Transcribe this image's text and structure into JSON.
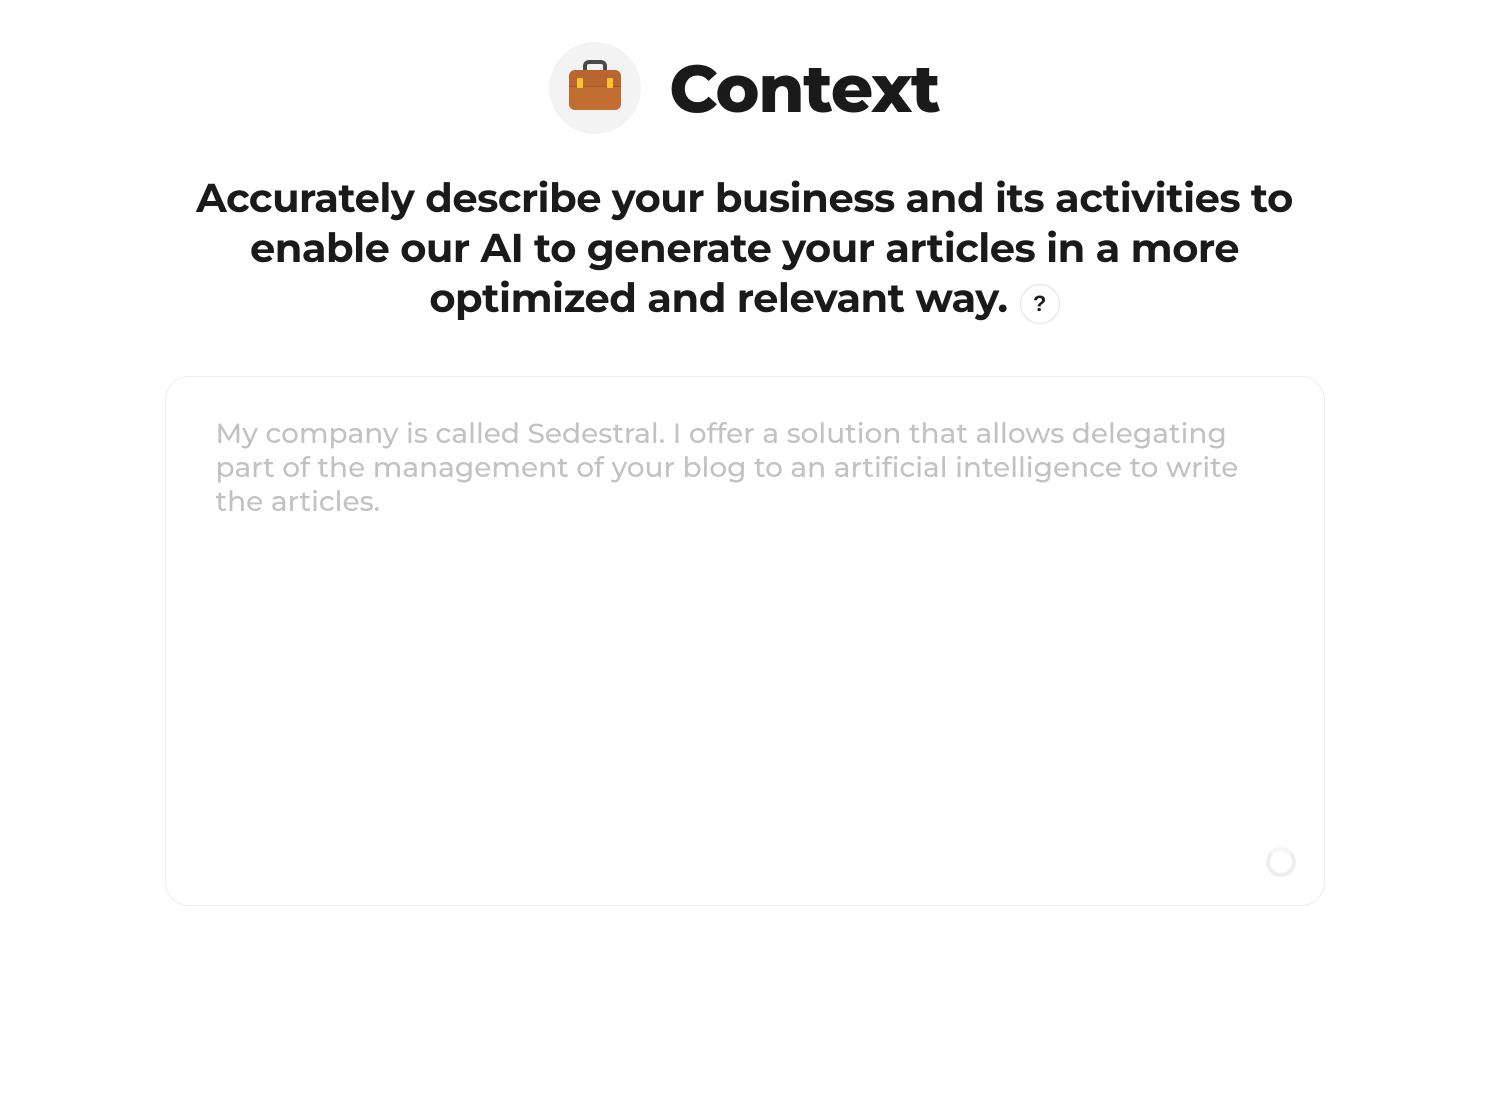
{
  "header": {
    "title": "Context",
    "icon": "briefcase-icon"
  },
  "description": "Accurately describe your business and its activities to enable our AI to generate your articles in a more optimized and relevant way.",
  "help_label": "?",
  "context_input": {
    "value": "",
    "placeholder": "My company is called Sedestral. I offer a solution that allows delegating part of the management of your blog to an artificial intelligence to write the articles."
  }
}
